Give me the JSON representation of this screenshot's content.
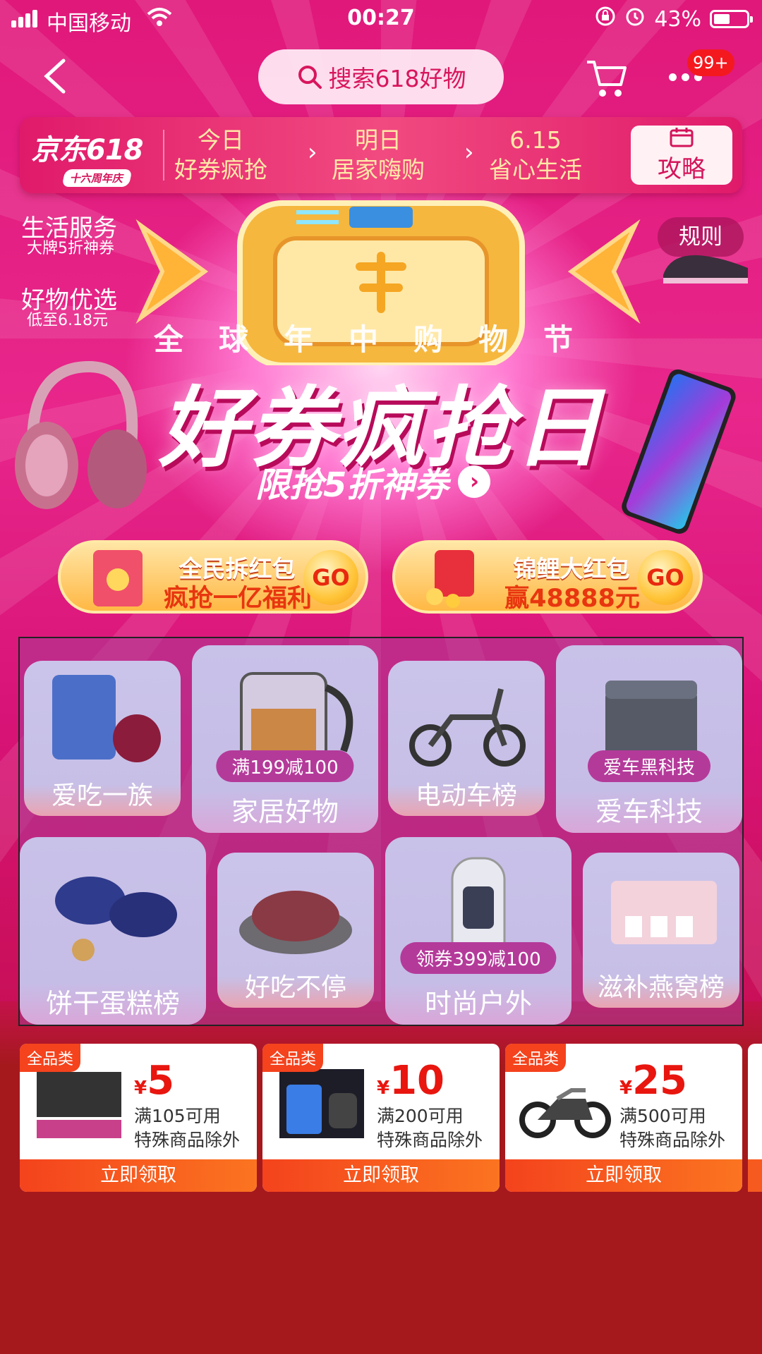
{
  "status_bar": {
    "carrier": "中国移动",
    "time": "00:27",
    "battery": "43%"
  },
  "nav": {
    "search_text": "搜索618好物",
    "cart_badge": "99+"
  },
  "schedule": {
    "logo_main": "京东618",
    "logo_sub": "十六周年庆",
    "items": [
      {
        "line1": "今日",
        "line2": "好券疯抢"
      },
      {
        "line1": "明日",
        "line2": "居家嗨购"
      },
      {
        "line1": "6.15",
        "line2": "省心生活"
      }
    ],
    "guide_label": "攻略"
  },
  "side_labels": [
    {
      "title": "生活服务",
      "sub": "大牌5折神券"
    },
    {
      "title": "好物优选",
      "sub": "低至6.18元"
    }
  ],
  "rules_label": "规则",
  "hero": {
    "subtitle": "全球年中购物节",
    "title": "好券疯抢日",
    "cta": "限抢5折神券"
  },
  "red_packets": [
    {
      "title": "全民拆红包",
      "desc": "疯抢一亿福利",
      "go": "GO"
    },
    {
      "title": "锦鲤大红包",
      "desc": "赢48888元",
      "go": "GO"
    }
  ],
  "categories": [
    {
      "label": "爱吃一族",
      "promo": ""
    },
    {
      "label": "家居好物",
      "promo": "满199减100"
    },
    {
      "label": "电动车榜",
      "promo": ""
    },
    {
      "label": "爱车科技",
      "promo": "爱车黑科技"
    },
    {
      "label": "饼干蛋糕榜",
      "promo": ""
    },
    {
      "label": "好吃不停",
      "promo": ""
    },
    {
      "label": "时尚户外",
      "promo": "领券399减100"
    },
    {
      "label": "滋补燕窝榜",
      "promo": ""
    }
  ],
  "coupons": [
    {
      "tag": "全品类",
      "yen": "¥",
      "amount": "5",
      "cond1": "满105可用",
      "cond2": "特殊商品除外",
      "button": "立即领取"
    },
    {
      "tag": "全品类",
      "yen": "¥",
      "amount": "10",
      "cond1": "满200可用",
      "cond2": "特殊商品除外",
      "button": "立即领取"
    },
    {
      "tag": "全品类",
      "yen": "¥",
      "amount": "25",
      "cond1": "满500可用",
      "cond2": "特殊商品除外",
      "button": "立即领取"
    }
  ],
  "colors": {
    "accent": "#e0187a",
    "coupon_red": "#f4431d",
    "bottom_bg": "#a5191d"
  }
}
